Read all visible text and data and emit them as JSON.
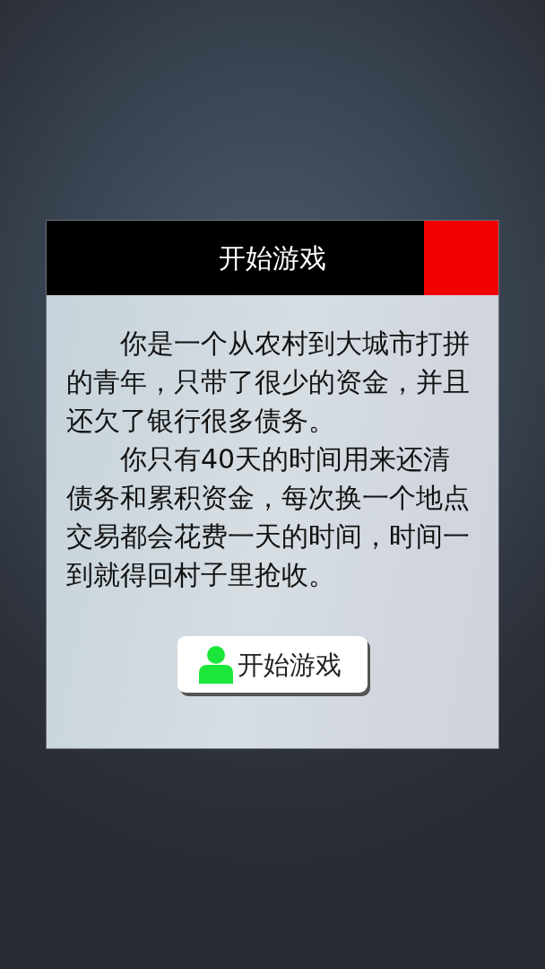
{
  "dialog": {
    "title": "开始游戏"
  },
  "paragraphs": [
    "你是一个从农村到大城市打拼的青年，只带了很少的资金，并且还欠了银行很多债务。",
    "你只有40天的时间用来还清债务和累积资金，每次换一个地点交易都会花费一天的时间，时间一到就得回村子里抢收。"
  ],
  "start_button": {
    "label": "开始游戏"
  }
}
